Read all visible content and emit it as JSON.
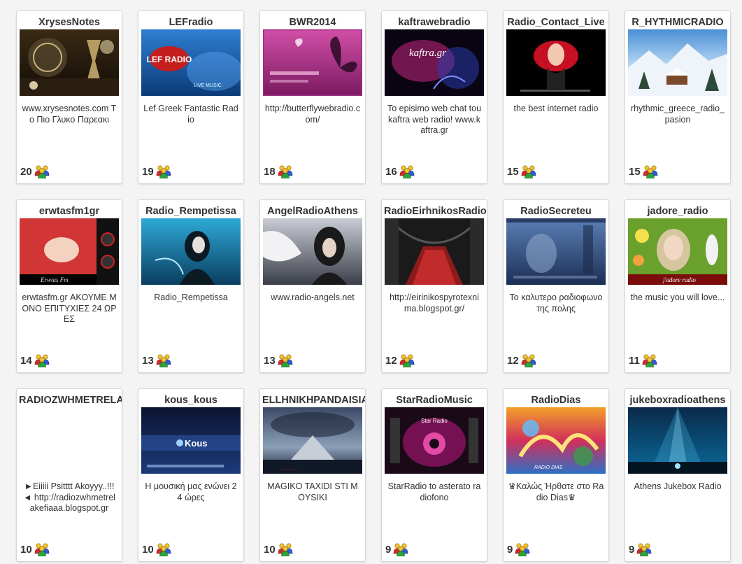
{
  "stations": [
    {
      "name": "XrysesNotes",
      "description": "www.xrysesnotes.com Το Πιο Γλυκο Παρεακι",
      "listeners": "20",
      "thumb": "xryses"
    },
    {
      "name": "LEFradio",
      "description": "Lef Greek Fantastic Radio",
      "listeners": "19",
      "thumb": "lef"
    },
    {
      "name": "BWR2014",
      "description": "http://butterflywebradio.com/",
      "listeners": "18",
      "thumb": "butterfly"
    },
    {
      "name": "kaftrawebradio",
      "description": "To episimo web chat tou kaftra web radio! www.kaftra.gr",
      "listeners": "16",
      "thumb": "kaftra"
    },
    {
      "name": "Radio_Contact_Live",
      "description": "the best internet radio",
      "listeners": "15",
      "thumb": "contact"
    },
    {
      "name": "R_HYTHMICRADIO",
      "description": "rhythmic_greece_radio_pasion",
      "listeners": "15",
      "thumb": "snow"
    },
    {
      "name": "erwtasfm1gr",
      "description": "erwtasfm.gr ΑΚΟΥΜΕ ΜΟΝΟ ΕΠΙΤΥΧΙΕΣ 24 ΩΡΕΣ",
      "listeners": "14",
      "thumb": "erwtas"
    },
    {
      "name": "Radio_Rempetissa",
      "description": "Radio_Rempetissa",
      "listeners": "13",
      "thumb": "rempetissa"
    },
    {
      "name": "AngelRadioAthens",
      "description": "www.radio-angels.net",
      "listeners": "13",
      "thumb": "angel"
    },
    {
      "name": "RadioEirhnikosRadiof",
      "description": "http://eirinikospyrotexnima.blogspot.gr/",
      "listeners": "12",
      "thumb": "bridge"
    },
    {
      "name": "RadioSecreteu",
      "description": "Το καλυτερο ραδιοφωνο της πολης",
      "listeners": "12",
      "thumb": "secret"
    },
    {
      "name": "jadore_radio",
      "description": "the music you will love...",
      "listeners": "11",
      "thumb": "jadore"
    },
    {
      "name": "RADIOZWHMETRELA",
      "description": "►Eiiiii Psitttt Akoyyy..!!!◄ http://radiozwhmetrelakefiaaa.blogspot.gr",
      "listeners": "10",
      "thumb": "blank"
    },
    {
      "name": "kous_kous",
      "description": "Η μουσική μας ενώνει 24 ώρες",
      "listeners": "10",
      "thumb": "kous"
    },
    {
      "name": "ELLHNIKHPANDAISIA",
      "description": "MAGIKO TAXIDI STI MOYSIKI",
      "listeners": "10",
      "thumb": "storm"
    },
    {
      "name": "StarRadioMusic",
      "description": "StarRadio to asterato radiofono",
      "listeners": "9",
      "thumb": "star"
    },
    {
      "name": "RadioDias",
      "description": "♛Καλώς Ήρθατε στο Radio Dias♛",
      "listeners": "9",
      "thumb": "dias"
    },
    {
      "name": "jukeboxradioathens",
      "description": "Athens Jukebox Radio",
      "listeners": "9",
      "thumb": "jukebox"
    }
  ],
  "thumb_texts": {
    "lef": "LEF RADIO",
    "lef_sub": "LIVE MUSIC",
    "kaftra": "kaftra.gr",
    "erwtas": "Erwtas Fm",
    "jadore": "j'adore radio",
    "kous": "Kous",
    "star": "Star Radio",
    "dias": "RADIO DIAS"
  },
  "icon": {
    "name": "listeners-icon"
  }
}
